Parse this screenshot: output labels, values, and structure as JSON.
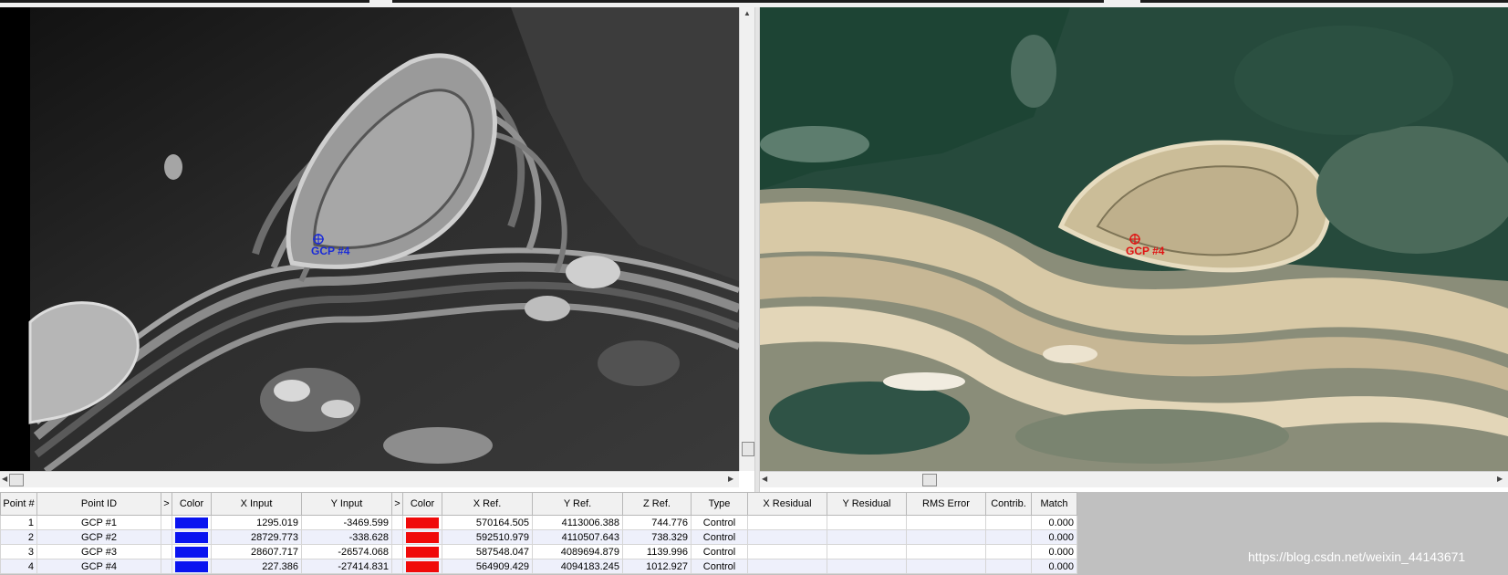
{
  "left_view": {
    "gcp_label": "GCP #4",
    "marker_color": "#1a2bd8"
  },
  "right_view": {
    "gcp_label": "GCP #4",
    "marker_color": "#e11313"
  },
  "table": {
    "headers": {
      "point_num": "Point #",
      "point_id": "Point ID",
      "expand_a": ">",
      "color_a": "Color",
      "x_input": "X Input",
      "y_input": "Y Input",
      "expand_b": ">",
      "color_b": "Color",
      "x_ref": "X Ref.",
      "y_ref": "Y Ref.",
      "z_ref": "Z Ref.",
      "type": "Type",
      "x_residual": "X Residual",
      "y_residual": "Y Residual",
      "rms_error": "RMS Error",
      "contrib": "Contrib.",
      "match": "Match"
    },
    "input_color": "#0a14f0",
    "ref_color": "#f00a0a",
    "rows": [
      {
        "num": "1",
        "id": "GCP #1",
        "x_input": "1295.019",
        "y_input": "-3469.599",
        "x_ref": "570164.505",
        "y_ref": "4113006.388",
        "z_ref": "744.776",
        "type": "Control",
        "x_residual": "",
        "y_residual": "",
        "rms_error": "",
        "contrib": "",
        "match": "0.000"
      },
      {
        "num": "2",
        "id": "GCP #2",
        "x_input": "28729.773",
        "y_input": "-338.628",
        "x_ref": "592510.979",
        "y_ref": "4110507.643",
        "z_ref": "738.329",
        "type": "Control",
        "x_residual": "",
        "y_residual": "",
        "rms_error": "",
        "contrib": "",
        "match": "0.000"
      },
      {
        "num": "3",
        "id": "GCP #3",
        "x_input": "28607.717",
        "y_input": "-26574.068",
        "x_ref": "587548.047",
        "y_ref": "4089694.879",
        "z_ref": "1139.996",
        "type": "Control",
        "x_residual": "",
        "y_residual": "",
        "rms_error": "",
        "contrib": "",
        "match": "0.000"
      },
      {
        "num": "4",
        "id": "GCP #4",
        "x_input": "227.386",
        "y_input": "-27414.831",
        "x_ref": "564909.429",
        "y_ref": "4094183.245",
        "z_ref": "1012.927",
        "type": "Control",
        "x_residual": "",
        "y_residual": "",
        "rms_error": "",
        "contrib": "",
        "match": "0.000"
      }
    ]
  },
  "watermark": "https://blog.csdn.net/weixin_44143671"
}
